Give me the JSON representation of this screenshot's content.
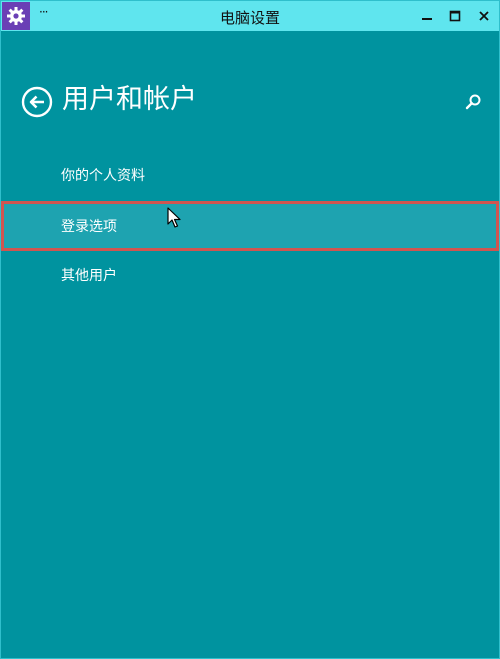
{
  "window": {
    "title": "电脑设置",
    "menu_dots": "···",
    "icons": {
      "app": "gear-icon",
      "minimize": "minimize-icon",
      "maximize": "maximize-icon",
      "close": "close-icon"
    }
  },
  "header": {
    "back_icon": "back-arrow-icon",
    "title": "用户和帐户",
    "search_icon": "search-icon"
  },
  "nav": {
    "items": [
      {
        "label": "你的个人资料",
        "selected": false
      },
      {
        "label": "登录选项",
        "selected": true
      },
      {
        "label": "其他用户",
        "selected": false
      }
    ]
  },
  "colors": {
    "background": "#00939f",
    "titlebar": "#5fe5ee",
    "app_icon_bg": "#6a3fb5",
    "selected_item": "#1ea3b0",
    "highlight_border": "#d05550"
  }
}
